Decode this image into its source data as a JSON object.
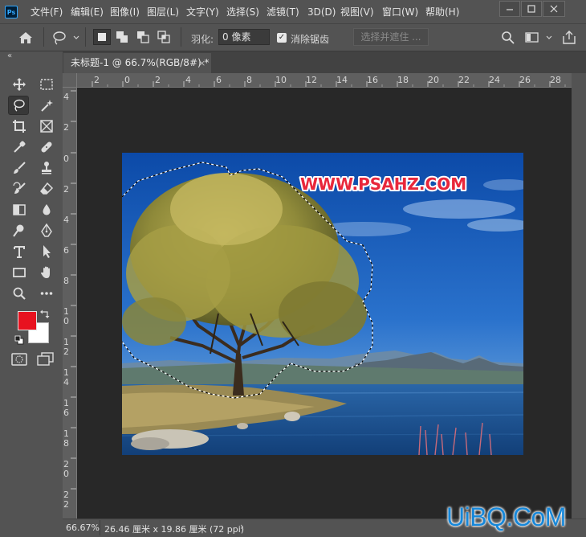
{
  "app": {
    "logo_text": "Ps"
  },
  "menu": [
    "文件(F)",
    "编辑(E)",
    "图像(I)",
    "图层(L)",
    "文字(Y)",
    "选择(S)",
    "滤镜(T)",
    "3D(D)",
    "视图(V)",
    "窗口(W)",
    "帮助(H)"
  ],
  "options": {
    "feather_label": "羽化:",
    "feather_value": "0 像素",
    "antialias_label": "消除锯齿",
    "antialias_checked": true,
    "select_mask_label": "选择并遮住 ..."
  },
  "document": {
    "tab_title": "未标题-1 @ 66.7%(RGB/8#) *",
    "close_glyph": "×",
    "image_banner": "WWW.PSAHZ.COM"
  },
  "rulers": {
    "top": [
      "2",
      "0",
      "2",
      "4",
      "6",
      "8",
      "10",
      "12",
      "14",
      "16",
      "18",
      "20",
      "22",
      "24",
      "26",
      "28"
    ],
    "left": [
      "4",
      "2",
      "0",
      "2",
      "4",
      "6",
      "8",
      "1 0",
      "1 2",
      "1 4",
      "1 6",
      "1 8",
      "2 0",
      "2 2"
    ]
  },
  "tools": [
    "move-icon",
    "marquee-icon",
    "lasso-icon",
    "magic-wand-icon",
    "crop-icon",
    "frame-icon",
    "eyedropper-icon",
    "healing-icon",
    "brush-icon",
    "stamp-icon",
    "history-brush-icon",
    "eraser-icon",
    "gradient-icon",
    "blur-icon",
    "dodge-icon",
    "pen-icon",
    "type-icon",
    "path-select-icon",
    "rectangle-icon",
    "hand-icon",
    "zoom-icon",
    "more-icon"
  ],
  "colors": {
    "foreground": "#e8121f",
    "background": "#ffffff",
    "accent": "#31a8ff"
  },
  "status": {
    "zoom": "66.67%",
    "doc_size": "26.46 厘米 x 19.86 厘米 (72 ppi)",
    "arrow": "›"
  },
  "watermark": "UiBQ.CoM"
}
